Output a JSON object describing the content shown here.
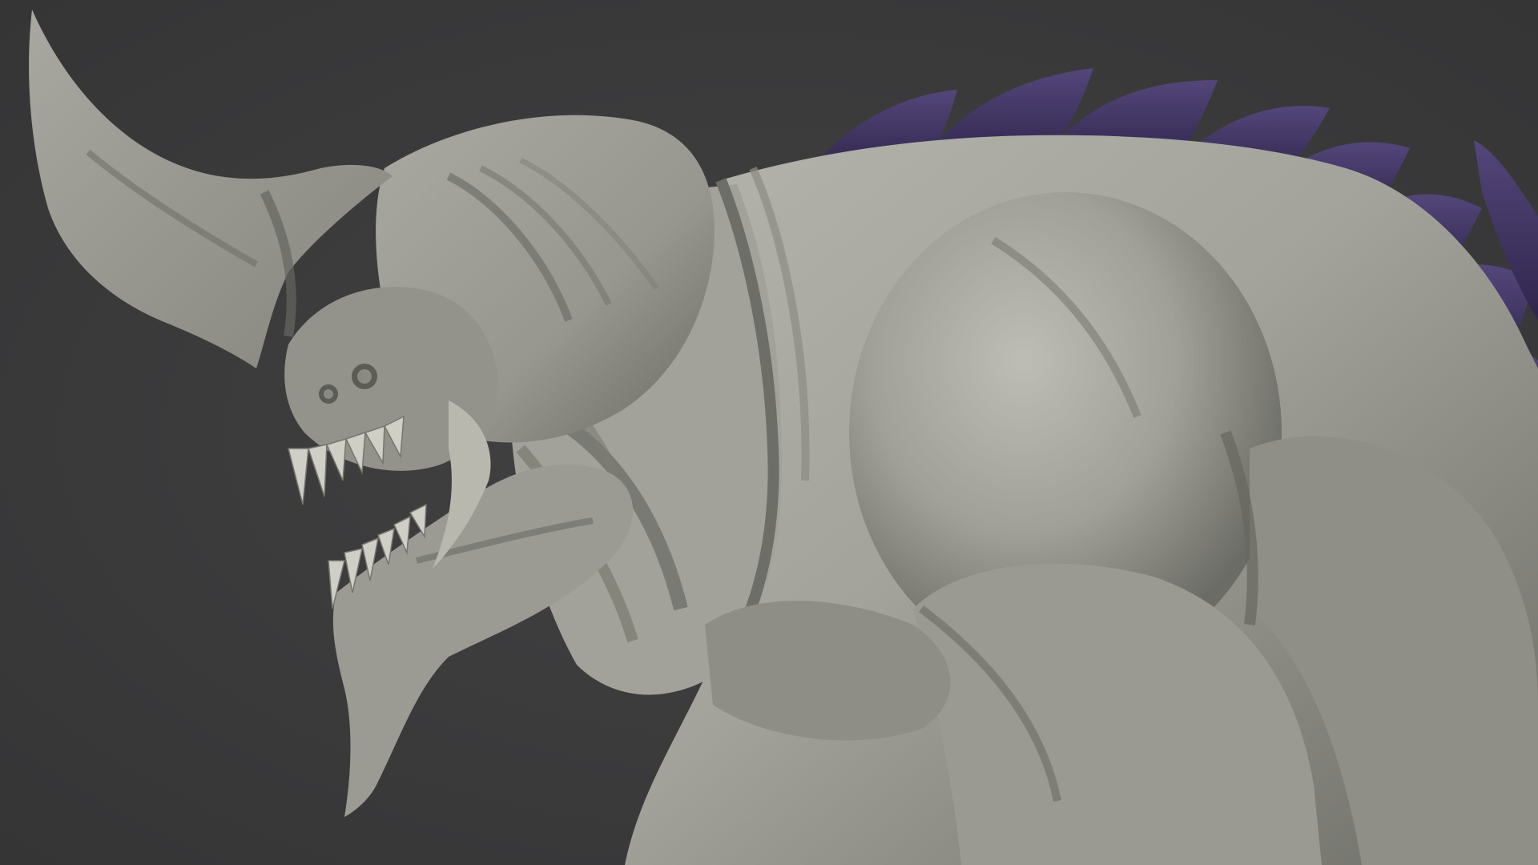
{
  "scene": {
    "subject": "",
    "background_color": "#3b3b3c",
    "clay_color": "#9e9e96",
    "clay_shadow_color": "#5a5a55",
    "clay_highlight_color": "#c2c2ba",
    "spine_color": "#3a2e5c",
    "spine_highlight_color": "#5a4a80"
  }
}
